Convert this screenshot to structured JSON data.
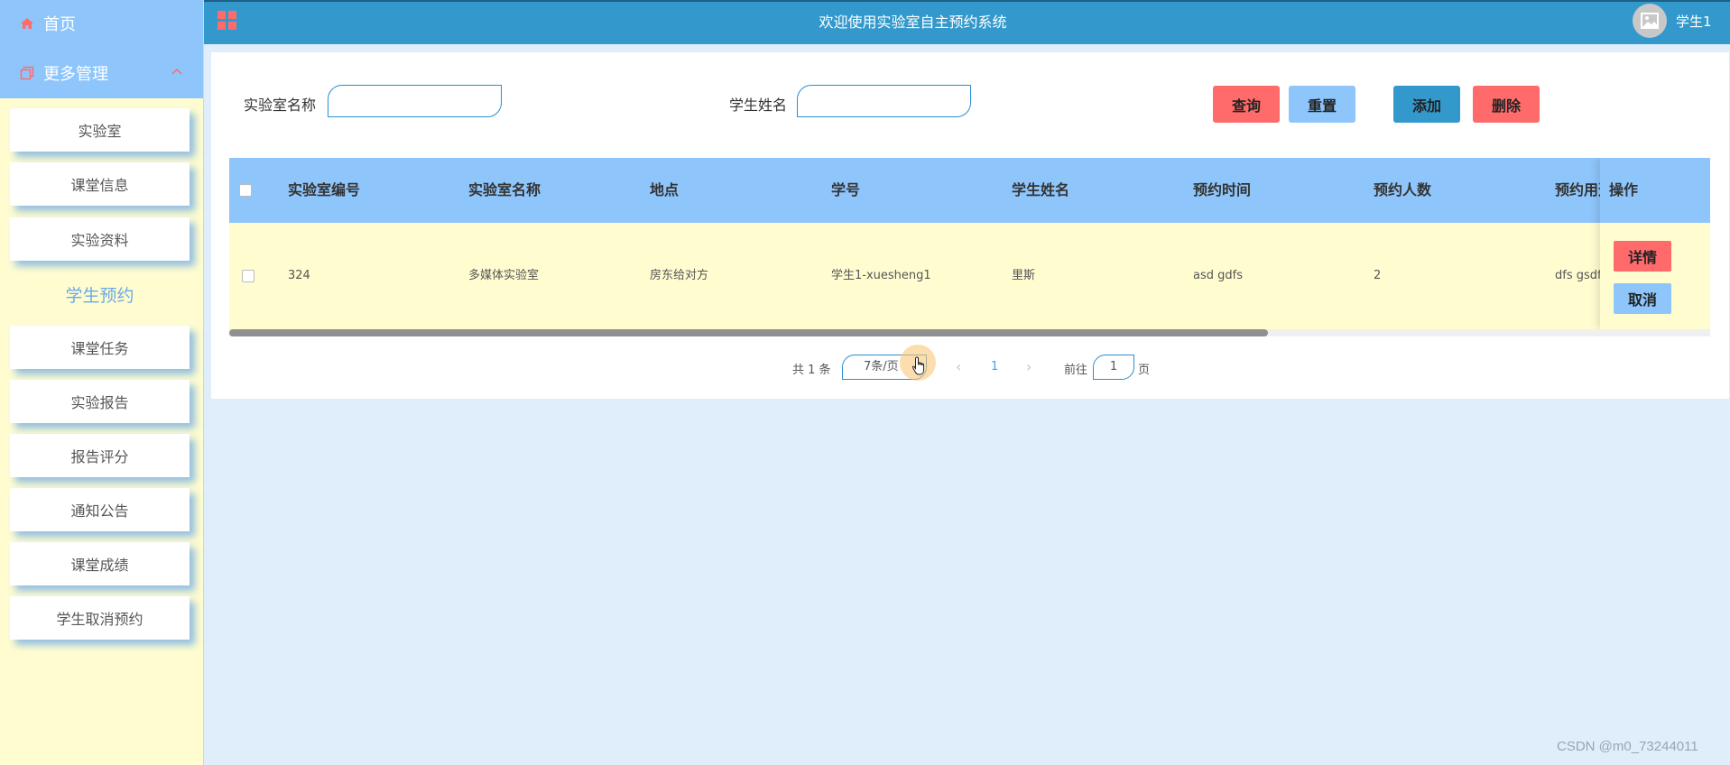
{
  "sidebar": {
    "home_label": "首页",
    "manage_label": "更多管理",
    "items": [
      {
        "label": "实验室"
      },
      {
        "label": "课堂信息"
      },
      {
        "label": "实验资料"
      },
      {
        "label": "学生预约",
        "active": true
      },
      {
        "label": "课堂任务"
      },
      {
        "label": "实验报告"
      },
      {
        "label": "报告评分"
      },
      {
        "label": "通知公告"
      },
      {
        "label": "课堂成绩"
      },
      {
        "label": "学生取消预约"
      }
    ]
  },
  "header": {
    "title": "欢迎使用实验室自主预约系统",
    "user_name": "学生1"
  },
  "search": {
    "lab_name_label": "实验室名称",
    "lab_name_value": "",
    "student_name_label": "学生姓名",
    "student_name_value": "",
    "query_button": "查询",
    "reset_button": "重置",
    "add_button": "添加",
    "delete_button": "删除"
  },
  "table": {
    "columns": [
      "实验室编号",
      "实验室名称",
      "地点",
      "学号",
      "学生姓名",
      "预约时间",
      "预约人数",
      "预约用途",
      "操作"
    ],
    "rows": [
      {
        "lab_no": "324",
        "lab_name": "多媒体实验室",
        "location": "房东给对方",
        "student_id": "学生1-xuesheng1",
        "student_name": "里斯",
        "time": "asd gdfs",
        "count": "2",
        "purpose": "dfs gsdf",
        "detail_button": "详情",
        "cancel_button": "取消"
      }
    ]
  },
  "pagination": {
    "total_text": "共 1 条",
    "page_size": "7条/页",
    "current_page": "1",
    "goto_label": "前往",
    "goto_value": "1",
    "page_suffix": "页"
  },
  "watermark": "CSDN @m0_73244011",
  "colors": {
    "topbar": "#3399cc",
    "sidebar_head": "#8ec5fb",
    "sidebar_bg": "#fffdd0",
    "table_header": "#8ec5fb",
    "row_bg": "#fffdd0",
    "danger": "#ff6b6b",
    "secondary": "#8ec5fb",
    "primary": "#3399cc"
  }
}
